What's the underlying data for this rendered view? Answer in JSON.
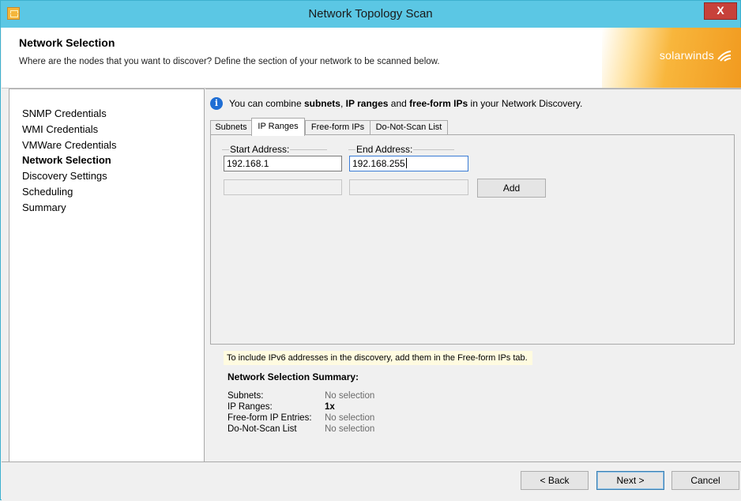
{
  "window": {
    "title": "Network Topology Scan",
    "close_label": "X"
  },
  "header": {
    "title": "Network Selection",
    "description": "Where are the nodes that you want to discover? Define the section of your network to be scanned below.",
    "brand": "solarwinds"
  },
  "sidebar": {
    "items": [
      {
        "label": "SNMP Credentials",
        "active": false
      },
      {
        "label": "WMI Credentials",
        "active": false
      },
      {
        "label": "VMWare Credentials",
        "active": false
      },
      {
        "label": "Network Selection",
        "active": true
      },
      {
        "label": "Discovery Settings",
        "active": false
      },
      {
        "label": "Scheduling",
        "active": false
      },
      {
        "label": "Summary",
        "active": false
      }
    ]
  },
  "info": {
    "icon": "info-icon",
    "part1": "You can combine ",
    "bold1": "subnets",
    "part2": ", ",
    "bold2": "IP ranges",
    "part3": " and ",
    "bold3": "free-form IPs",
    "part4": " in your Network Discovery."
  },
  "tabs": [
    {
      "label": "Subnets",
      "active": false
    },
    {
      "label": "IP Ranges",
      "active": true
    },
    {
      "label": "Free-form IPs",
      "active": false
    },
    {
      "label": "Do-Not-Scan List",
      "active": false
    }
  ],
  "ip_ranges": {
    "start_label": "Start Address:",
    "end_label": "End Address:",
    "start_value": "192.168.1",
    "end_value": "192.168.255",
    "add_label": "Add"
  },
  "ipv6_note": "To include IPv6 addresses in the discovery, add them in the Free-form IPs tab.",
  "summary": {
    "title": "Network Selection Summary:",
    "rows": [
      {
        "key": "Subnets:",
        "value": "No selection"
      },
      {
        "key": "IP Ranges:",
        "value": "1x"
      },
      {
        "key": "Free-form IP Entries:",
        "value": "No selection"
      },
      {
        "key": "Do-Not-Scan List",
        "value": "No selection"
      }
    ]
  },
  "footer": {
    "back_label": "< Back",
    "next_label": "Next >",
    "cancel_label": "Cancel"
  },
  "colors": {
    "titlebar": "#5bc7e4",
    "close": "#c7413a",
    "brand": "#f19a1f",
    "info": "#1f6ed4"
  }
}
